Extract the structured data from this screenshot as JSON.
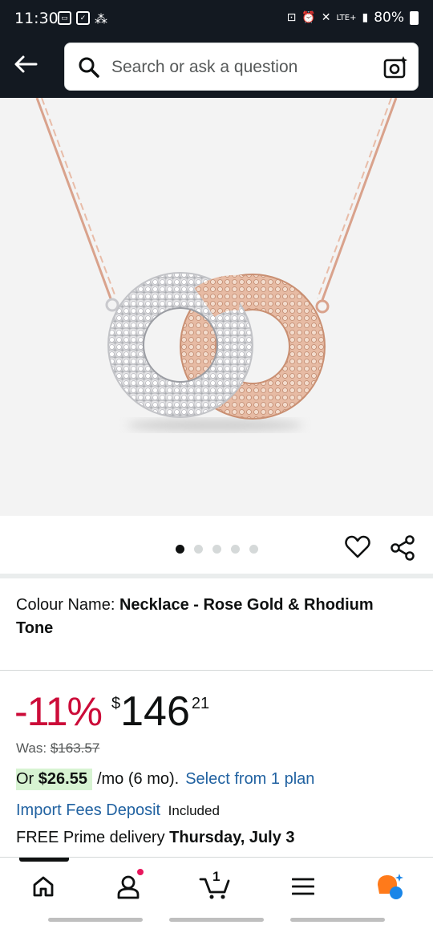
{
  "status_bar": {
    "time": "11:30",
    "network": "LTE+",
    "battery": "80%"
  },
  "search": {
    "placeholder": "Search or ask a question"
  },
  "product": {
    "image_alt": "Interlocking rings necklace",
    "carousel": {
      "total": 5,
      "active_index": 0
    },
    "colour_label": "Colour Name:",
    "colour_value": "Necklace - Rose Gold & Rhodium Tone"
  },
  "price": {
    "discount": "-11%",
    "currency_symbol": "$",
    "whole": "146",
    "fraction": "21",
    "was_label": "Was:",
    "was_value": "$163.57"
  },
  "plan": {
    "or": "Or",
    "amount": "$26.55",
    "suffix": "/mo (6 mo).",
    "link": "Select from 1 plan"
  },
  "import": {
    "link": "Import Fees Deposit",
    "included": "Included"
  },
  "delivery": {
    "prefix": "FREE Prime delivery",
    "date": "Thursday, July 3"
  },
  "bottom_nav": {
    "cart_count": "1",
    "items": [
      "home",
      "account",
      "cart",
      "menu",
      "rufus"
    ]
  },
  "colors": {
    "header_bg": "#131921",
    "discount": "#cc0c39",
    "link": "#2162a1",
    "plan_badge": "#d7f3d2"
  }
}
